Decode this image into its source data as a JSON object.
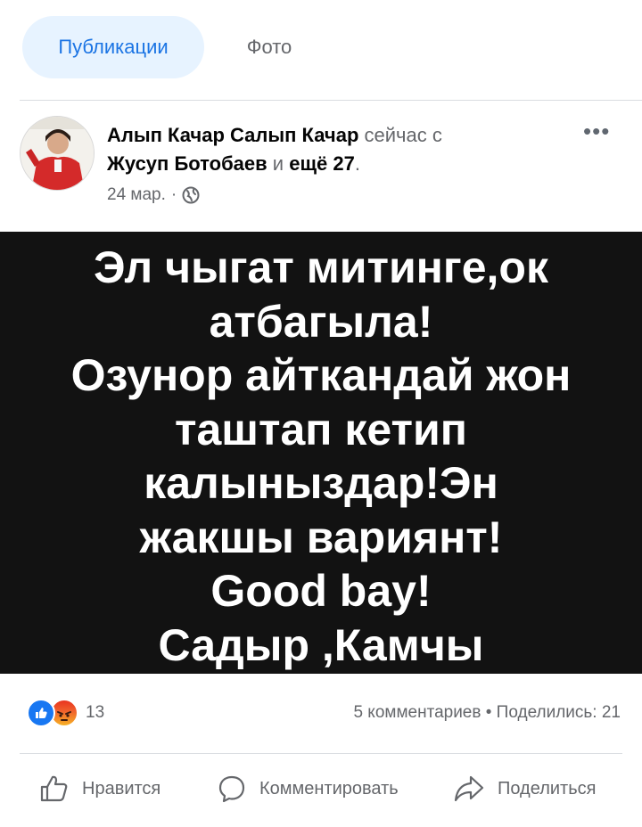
{
  "tabs": {
    "publications": "Публикации",
    "photo": "Фото"
  },
  "post": {
    "author": "Алып Качар Салып Качар",
    "with_text": "сейчас с",
    "tagged": "Жусуп Ботобаев",
    "and_text": "и",
    "more_tagged": "ещё 27",
    "period": ".",
    "date": "24 мар.",
    "dot": "·",
    "more_icon": "•••",
    "image_lines": [
      "Эл чыгат митинге,ок",
      "атбагыла!",
      "Озунор айткандай жон",
      "таштап кетип",
      "калыныздар!Эн",
      "жакшы вариянт!",
      "Good bay!",
      "Садыр ,Камчы"
    ]
  },
  "stats": {
    "reaction_count": "13",
    "comments_shares": "5 комментариев • Поделились: 21"
  },
  "actions": {
    "like": "Нравится",
    "comment": "Комментировать",
    "share": "Поделиться"
  },
  "colors": {
    "accent": "#1b74e4",
    "like_blue": "#1877f2",
    "muted": "#65676b",
    "image_bg": "#121212"
  }
}
